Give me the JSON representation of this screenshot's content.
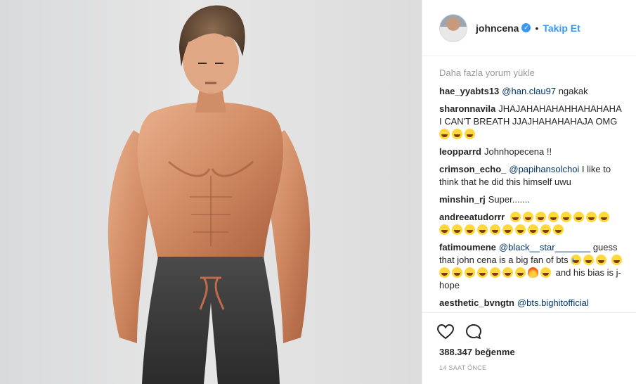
{
  "header": {
    "username": "johncena",
    "verified_icon": "verified-badge-icon",
    "separator": "•",
    "follow_label": "Takip Et"
  },
  "load_more": "Daha fazla yorum yükle",
  "comments": [
    {
      "user": "hae_yyabts13",
      "mention": "@han.clau97",
      "text": " ngakak"
    },
    {
      "user": "sharonnavila",
      "text": "JHAJAHAHAHAHHAHAHAHA I CAN'T BREATH JJAJHAHAHAHAJA OMG"
    },
    {
      "user": "leopparrd",
      "text": "Johnhopecena !!"
    },
    {
      "user": "crimson_echo_",
      "mention": "@papihansolchoi",
      "text": " I like to think that he did this himself uwu"
    },
    {
      "user": "minshin_rj",
      "text": "Super......."
    },
    {
      "user": "andreeatudorrr",
      "text": ""
    },
    {
      "user": "fatimoumene",
      "mention": "@black__star_______",
      "text": " guess that john cena is a big fan of bts",
      "text_after": " and his bias is j-hope"
    },
    {
      "user": "aesthetic_bvngtn",
      "mention": "@bts.bighitofficial",
      "text": ""
    }
  ],
  "likes": "388.347 beğenme",
  "timestamp": "14 SAAT ÖNCE",
  "icons": [
    "heart-icon",
    "comment-icon"
  ],
  "colors": {
    "accent": "#3897f0",
    "mention": "#003569",
    "muted": "#999999"
  }
}
